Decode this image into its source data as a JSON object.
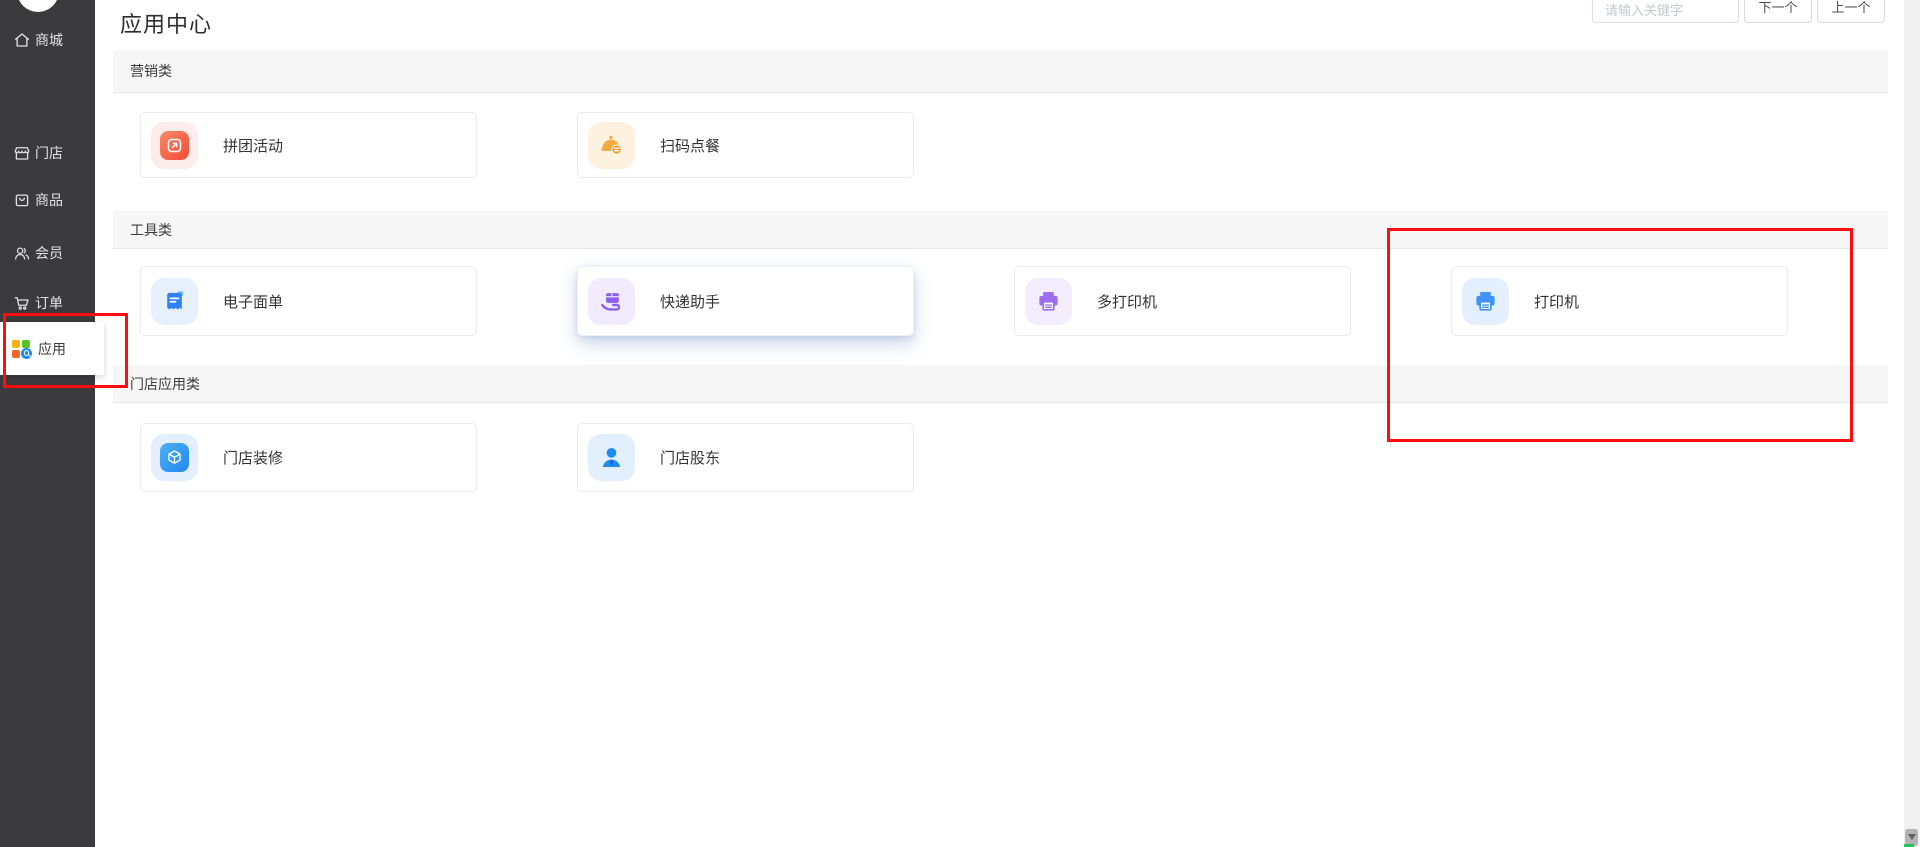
{
  "sidebar": {
    "items": [
      {
        "label": "商城",
        "icon": "home-icon"
      },
      {
        "label": "门店",
        "icon": "store-icon"
      },
      {
        "label": "商品",
        "icon": "goods-icon"
      },
      {
        "label": "会员",
        "icon": "member-icon"
      },
      {
        "label": "订单",
        "icon": "order-cart-icon"
      },
      {
        "label": "应用",
        "icon": "apps-grid-icon",
        "active": true
      }
    ]
  },
  "header": {
    "title": "应用中心",
    "search_placeholder": "请输入关键字",
    "next_button": "下一个",
    "prev_button": "上一个"
  },
  "categories": [
    {
      "name": "营销类",
      "apps": [
        {
          "name": "拼团活动",
          "icon": "group-buy-icon"
        },
        {
          "name": "扫码点餐",
          "icon": "scan-order-icon"
        }
      ]
    },
    {
      "name": "工具类",
      "apps": [
        {
          "name": "电子面单",
          "icon": "e-waybill-icon"
        },
        {
          "name": "快递助手",
          "icon": "express-helper-icon",
          "hovered": true
        },
        {
          "name": "多打印机",
          "icon": "multi-printer-icon"
        },
        {
          "name": "打印机",
          "icon": "printer-icon"
        }
      ]
    },
    {
      "name": "门店应用类",
      "apps": [
        {
          "name": "门店装修",
          "icon": "store-decor-icon"
        },
        {
          "name": "门店股东",
          "icon": "store-shareholder-icon"
        }
      ]
    }
  ],
  "annotations": {
    "count": 2,
    "color": "#fd0d0d",
    "targets": [
      "sidebar-应用",
      "card-打印机-region"
    ]
  },
  "colors": {
    "sidebar_bg": "#3b3b3d",
    "category_bar_bg": "#f6f6f6",
    "accent_red": "#f44a39",
    "accent_orange": "#f3a93c",
    "accent_blue": "#2e82f1",
    "accent_purple": "#8a5ef2"
  }
}
